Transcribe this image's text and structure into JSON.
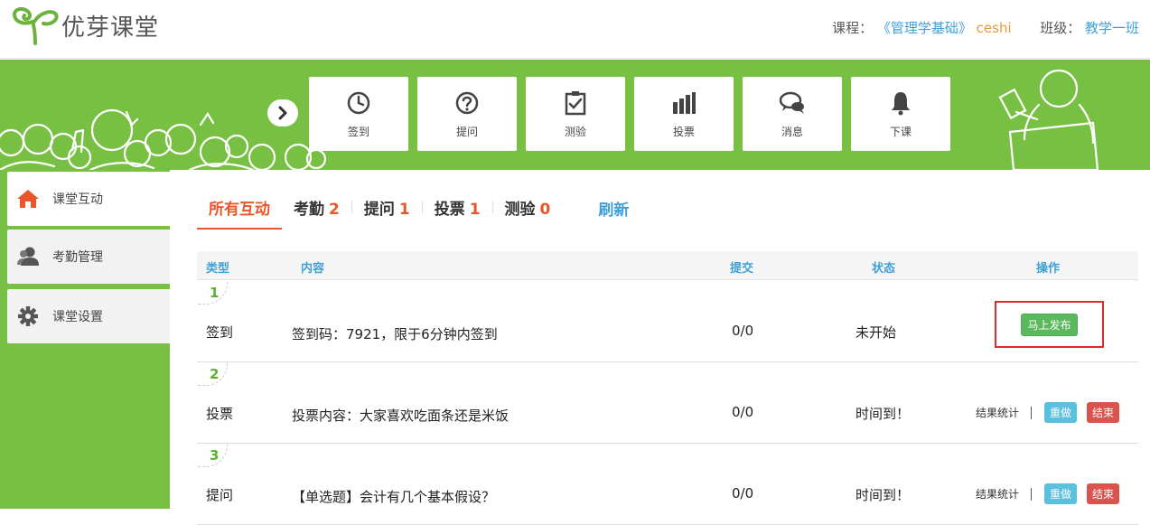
{
  "header": {
    "logo_text": "优芽课堂",
    "course_label": "课程：",
    "course_name": "《管理学基础》",
    "course_user": "ceshi",
    "class_label": "班级：",
    "class_name": "教学一班"
  },
  "toolbar": {
    "toggle_icon": "chevron-right-icon",
    "tools": [
      {
        "label": "签到",
        "icon": "clock-icon"
      },
      {
        "label": "提问",
        "icon": "question-icon"
      },
      {
        "label": "测验",
        "icon": "clipboard-check-icon"
      },
      {
        "label": "投票",
        "icon": "bar-chart-icon"
      },
      {
        "label": "消息",
        "icon": "chat-bubbles-icon"
      },
      {
        "label": "下课",
        "icon": "bell-icon"
      }
    ]
  },
  "sidebar": {
    "items": [
      {
        "label": "课堂互动",
        "icon": "home-icon",
        "active": true
      },
      {
        "label": "考勤管理",
        "icon": "users-icon",
        "active": false
      },
      {
        "label": "课堂设置",
        "icon": "gear-icon",
        "active": false
      }
    ]
  },
  "tabs": [
    {
      "label": "所有互动",
      "count": null,
      "active": true
    },
    {
      "label": "考勤",
      "count": "2",
      "active": false
    },
    {
      "label": "提问",
      "count": "1",
      "active": false
    },
    {
      "label": "投票",
      "count": "1",
      "active": false
    },
    {
      "label": "测验",
      "count": "0",
      "active": false
    }
  ],
  "refresh_label": "刷新",
  "table": {
    "columns": [
      "类型",
      "内容",
      "提交",
      "状态",
      "操作"
    ],
    "rows": [
      {
        "index": "1",
        "type": "签到",
        "content": "签到码：7921，限于6分钟内签到",
        "submitted": "0/0",
        "status": "未开始",
        "action": "马上发布"
      },
      {
        "index": "2",
        "type": "投票",
        "content": "投票内容：大家喜欢吃面条还是米饭",
        "submitted": "0/0",
        "status": "时间到！",
        "stats": "结果统计",
        "redo": "重做",
        "end": "结束"
      },
      {
        "index": "3",
        "type": "提问",
        "content": "【单选题】会计有几个基本假设？",
        "submitted": "0/0",
        "status": "时间到！",
        "stats": "结果统计",
        "redo": "重做",
        "end": "结束"
      }
    ]
  },
  "colors": {
    "brand_green": "#78c043",
    "accent_orange": "#e8562a",
    "link_blue": "#3fa0d8",
    "highlight_red": "#e02b2b"
  }
}
